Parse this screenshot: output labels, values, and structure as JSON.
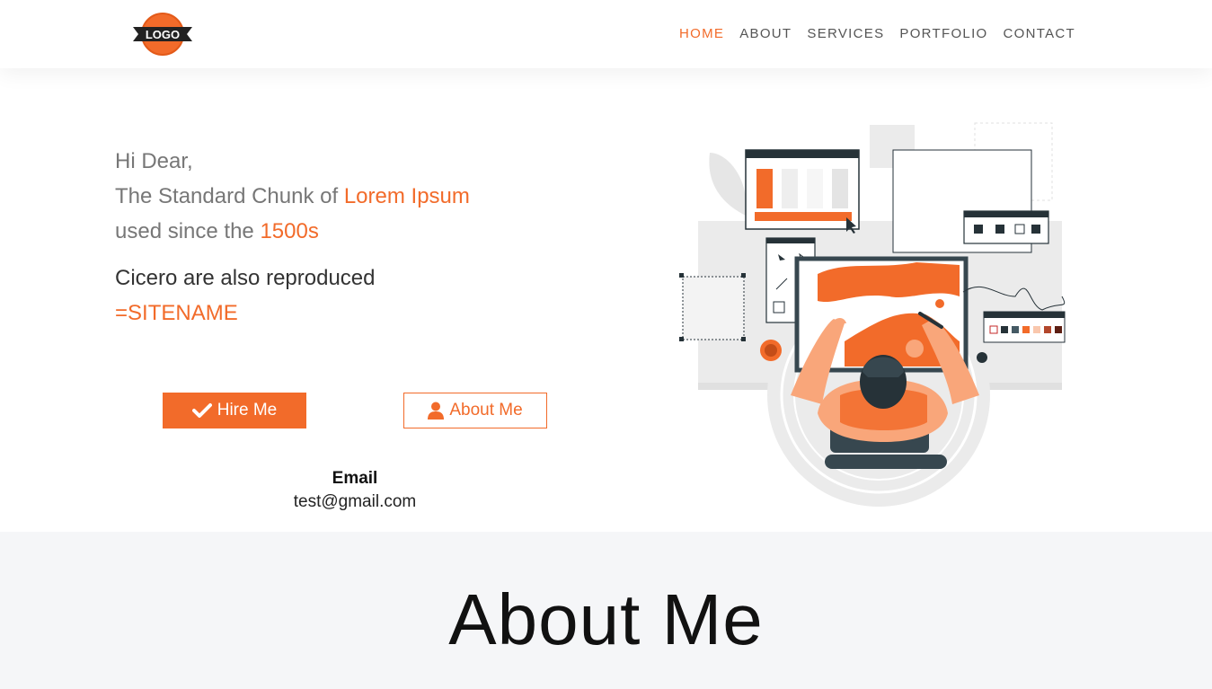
{
  "header": {
    "logo_text": "LOGO",
    "nav": [
      "HOME",
      "ABOUT",
      "SERVICES",
      "PORTFOLIO",
      "CONTACT"
    ],
    "active": "HOME"
  },
  "hero": {
    "line1": "Hi Dear,",
    "line2_prefix": "The Standard Chunk of ",
    "line2_accent": "Lorem Ipsum",
    "line3_prefix": "used since the ",
    "line3_accent": "1500s",
    "sub_line1": "Cicero are also reproduced",
    "sub_line2": "=SITENAME",
    "hire_button": "Hire Me",
    "about_button": "About Me",
    "email_label": "Email",
    "email_value": "test@gmail.com"
  },
  "about": {
    "title": "About Me"
  },
  "colors": {
    "accent": "#f26b2a",
    "about_bg": "#f5f6f8",
    "dark": "#263238"
  }
}
